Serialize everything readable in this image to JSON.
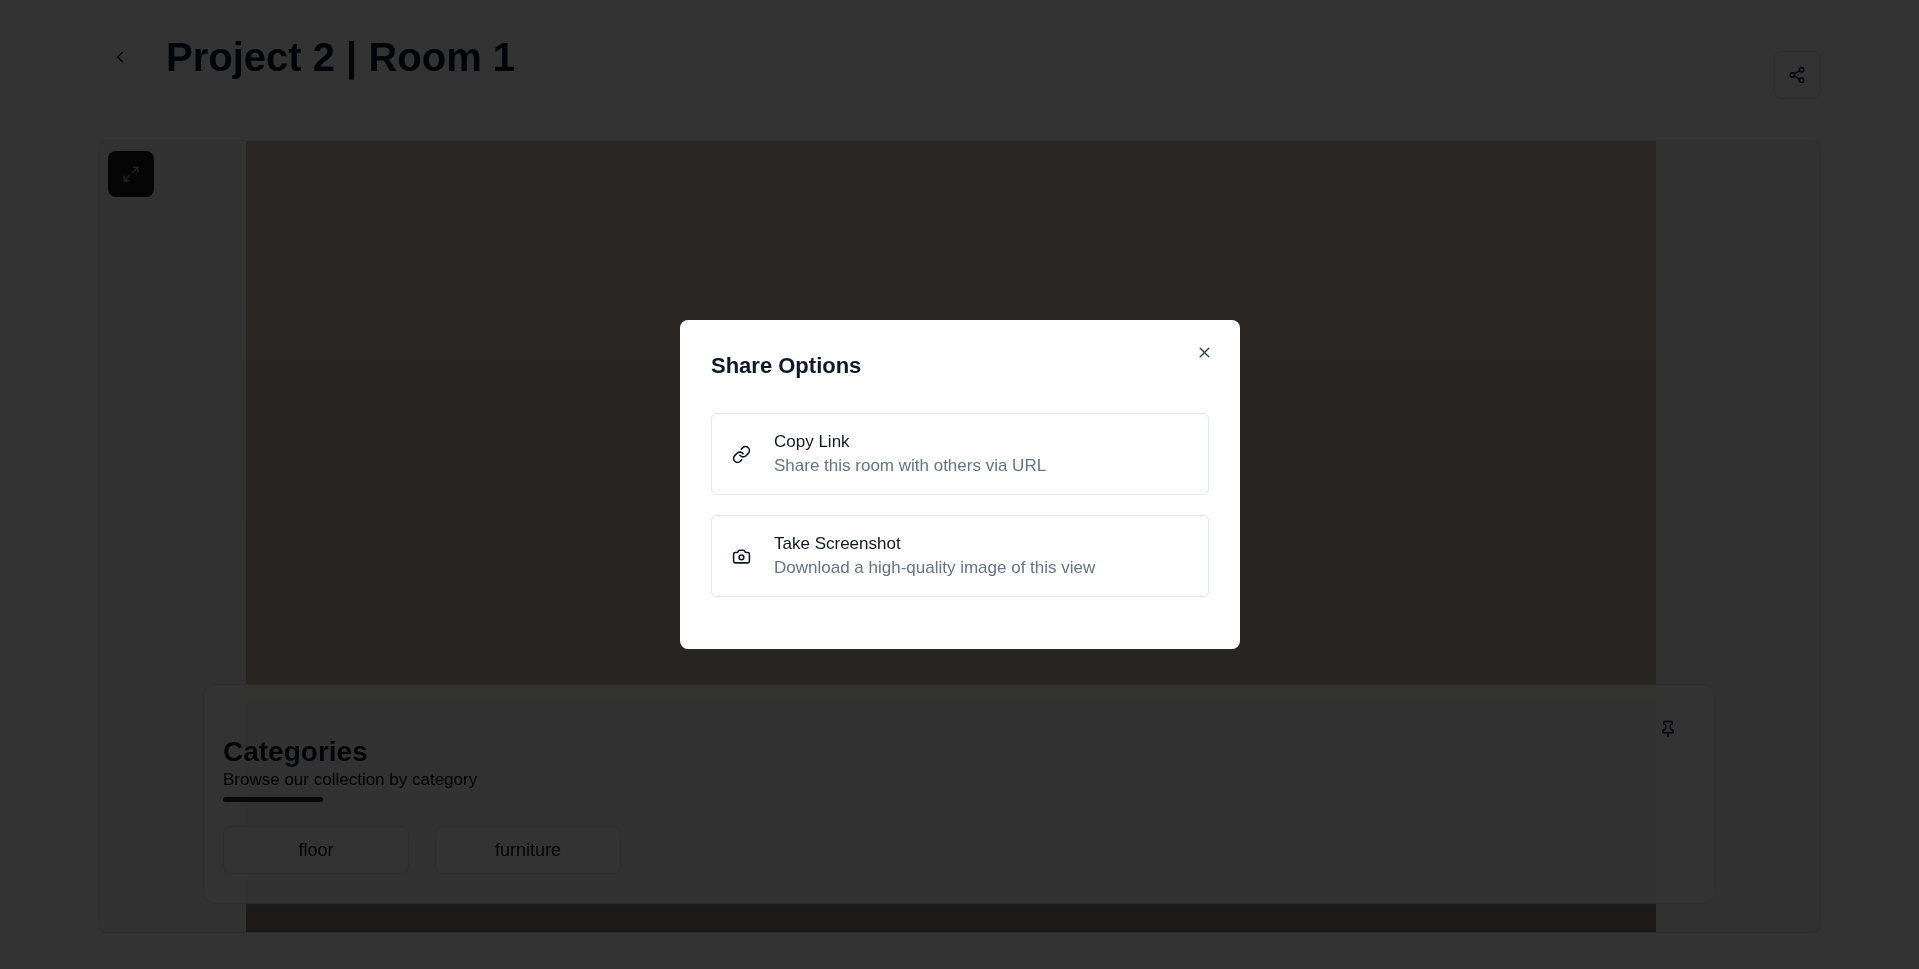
{
  "header": {
    "title": "Project 2 | Room 1"
  },
  "categories": {
    "title": "Categories",
    "subtitle": "Browse our collection by category",
    "items": [
      {
        "label": "floor"
      },
      {
        "label": "furniture"
      }
    ]
  },
  "dialog": {
    "title": "Share Options",
    "options": [
      {
        "kind": "link",
        "title": "Copy Link",
        "description": "Share this room with others via URL"
      },
      {
        "kind": "screenshot",
        "title": "Take Screenshot",
        "description": "Download a high-quality image of this view"
      }
    ]
  }
}
